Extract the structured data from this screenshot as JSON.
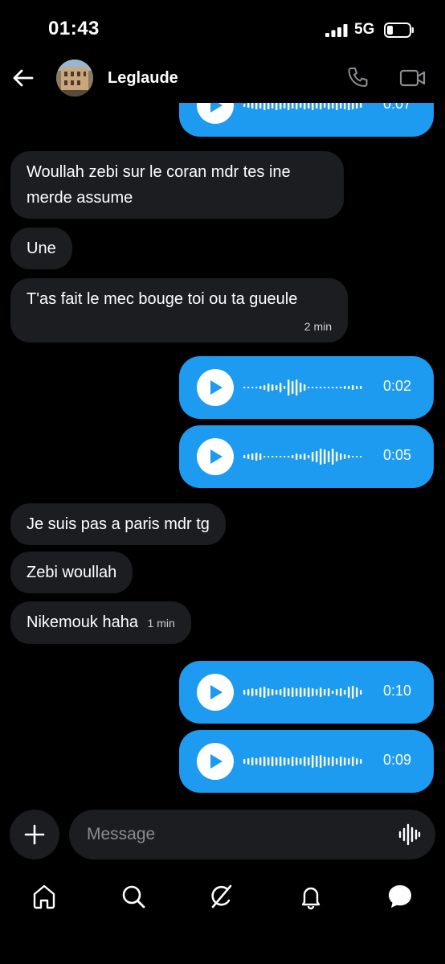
{
  "status_bar": {
    "time": "01:43",
    "network": "5G",
    "icons": [
      "signal-icon",
      "battery-icon"
    ]
  },
  "header": {
    "contact_name": "Leglaude",
    "icons": [
      "back-arrow-icon",
      "phone-icon",
      "video-camera-icon"
    ]
  },
  "messages": [
    {
      "type": "voice",
      "direction": "out",
      "duration": "0:07"
    },
    {
      "type": "text",
      "direction": "in",
      "text": "Woullah zebi sur le coran mdr tes ine merde assume"
    },
    {
      "type": "text",
      "direction": "in",
      "text": "Une"
    },
    {
      "type": "text",
      "direction": "in",
      "text": "T'as fait le mec bouge toi ou ta gueule",
      "time": "2 min"
    },
    {
      "type": "voice",
      "direction": "out",
      "duration": "0:02"
    },
    {
      "type": "voice",
      "direction": "out",
      "duration": "0:05"
    },
    {
      "type": "text",
      "direction": "in",
      "text": "Je suis pas a paris mdr tg"
    },
    {
      "type": "text",
      "direction": "in",
      "text": "Zebi woullah"
    },
    {
      "type": "text",
      "direction": "in",
      "text": "Nikemouk haha",
      "time": "1 min"
    },
    {
      "type": "voice",
      "direction": "out",
      "duration": "0:10"
    },
    {
      "type": "voice",
      "direction": "out",
      "duration": "0:09"
    }
  ],
  "composer": {
    "placeholder": "Message",
    "icons": [
      "plus-icon",
      "voice-wave-icon"
    ]
  },
  "nav": {
    "items": [
      "home-icon",
      "search-icon",
      "grok-icon",
      "notifications-bell-icon",
      "messages-icon"
    ]
  },
  "colors": {
    "background": "#000000",
    "incoming_bubble": "#1c1d21",
    "outgoing_bubble": "#1d9bf0",
    "text": "#ffffff",
    "muted": "#8a8d91"
  }
}
